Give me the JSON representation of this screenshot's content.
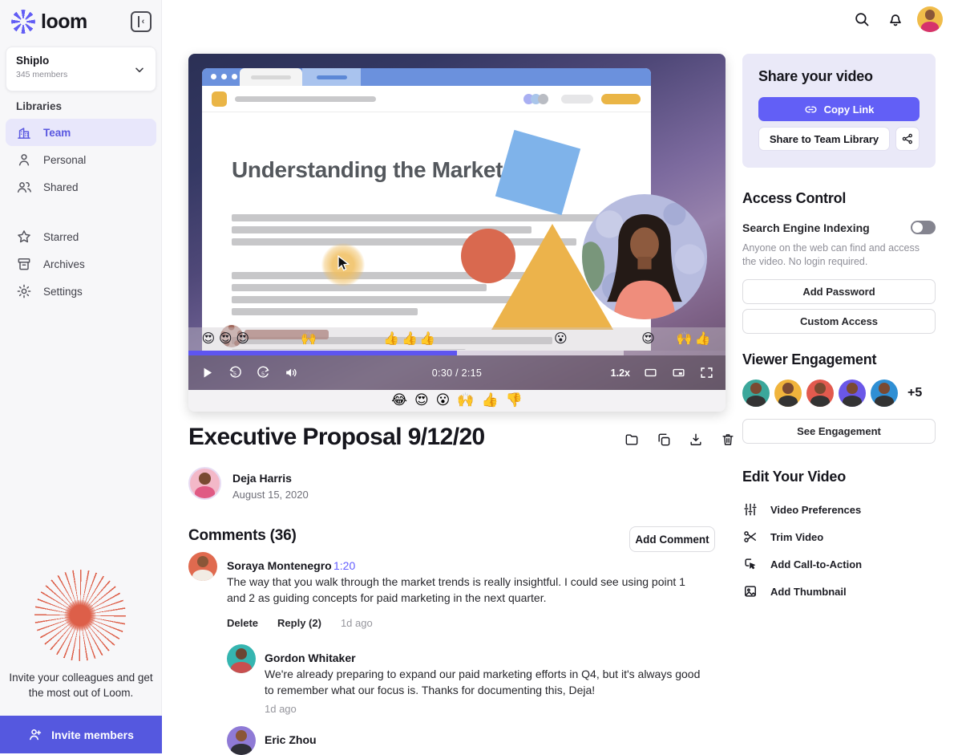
{
  "brand": {
    "name": "loom",
    "accent_purple": "#625DF5",
    "sunburst_coral": "#DD5F49"
  },
  "sidebar": {
    "workspace": {
      "name": "Shiplo",
      "members": "345 members"
    },
    "libraries_label": "Libraries",
    "library_items": [
      {
        "label": "Team",
        "icon": "building-icon",
        "active": true
      },
      {
        "label": "Personal",
        "icon": "person-icon",
        "active": false
      },
      {
        "label": "Shared",
        "icon": "people-icon",
        "active": false
      }
    ],
    "general_items": [
      {
        "label": "Starred",
        "icon": "star-icon"
      },
      {
        "label": "Archives",
        "icon": "archive-icon"
      },
      {
        "label": "Settings",
        "icon": "gear-icon"
      }
    ],
    "invite": {
      "message": "Invite your colleagues and get the most out of Loom.",
      "button_label": "Invite members"
    }
  },
  "player": {
    "slide_title": "Understanding the Market",
    "time": "0:30 / 2:15",
    "speed": "1.2x",
    "progress_percent": 50,
    "buffered_percent": 81,
    "timeline_reactions": [
      {
        "emoji": "😍",
        "pos": 3.7
      },
      {
        "emoji": "😍",
        "pos": 6.9
      },
      {
        "emoji": "😍",
        "pos": 10.1
      },
      {
        "emoji": "🙌",
        "pos": 22.4
      },
      {
        "emoji": "👍",
        "pos": 37.8
      },
      {
        "emoji": "👍",
        "pos": 41.2
      },
      {
        "emoji": "👍",
        "pos": 44.5
      },
      {
        "emoji": "😮",
        "pos": 69.3
      },
      {
        "emoji": "😍",
        "pos": 85.6
      },
      {
        "emoji": "🙌",
        "pos": 92.3
      },
      {
        "emoji": "👍",
        "pos": 95.8
      }
    ],
    "reaction_bar": [
      "😂",
      "😍",
      "😮",
      "🙌",
      "👍",
      "👎"
    ]
  },
  "video": {
    "title": "Executive Proposal 9/12/20",
    "author": "Deja Harris",
    "date": "August 15, 2020"
  },
  "comments": {
    "heading": "Comments (36)",
    "add_button": "Add Comment",
    "items": [
      {
        "author": "Soraya Montenegro",
        "timestamp_link": "1:20",
        "body": "The way that you walk through the market trends is really insightful. I could see using point 1 and 2 as guiding concepts for paid marketing in the next quarter.",
        "actions": {
          "delete": "Delete",
          "reply": "Reply (2)",
          "time": "1d ago"
        },
        "replies": [
          {
            "author": "Gordon Whitaker",
            "body": "We're already preparing to expand our paid marketing efforts in Q4, but it's always good to remember what our focus is. Thanks for documenting this, Deja!",
            "time": "1d ago"
          },
          {
            "author": "Eric Zhou"
          }
        ]
      }
    ]
  },
  "share": {
    "heading": "Share your video",
    "copy_link_label": "Copy Link",
    "team_library_label": "Share to Team Library"
  },
  "access": {
    "heading": "Access Control",
    "toggle_label": "Search Engine Indexing",
    "toggle_state": "off",
    "description": "Anyone on the web can find and access the video. No login required.",
    "add_password_label": "Add Password",
    "custom_access_label": "Custom Access"
  },
  "engagement": {
    "heading": "Viewer Engagement",
    "overflow_label": "+5",
    "button_label": "See Engagement",
    "avatar_colors": [
      "#3BA79B",
      "#F0B43C",
      "#E25A4E",
      "#6A57E8",
      "#2F8FD4"
    ]
  },
  "edit": {
    "heading": "Edit Your Video",
    "items": [
      {
        "icon": "sliders-icon",
        "label": "Video Preferences"
      },
      {
        "icon": "scissors-icon",
        "label": "Trim Video"
      },
      {
        "icon": "cursor-click-icon",
        "label": "Add Call-to-Action"
      },
      {
        "icon": "image-icon",
        "label": "Add Thumbnail"
      }
    ]
  }
}
